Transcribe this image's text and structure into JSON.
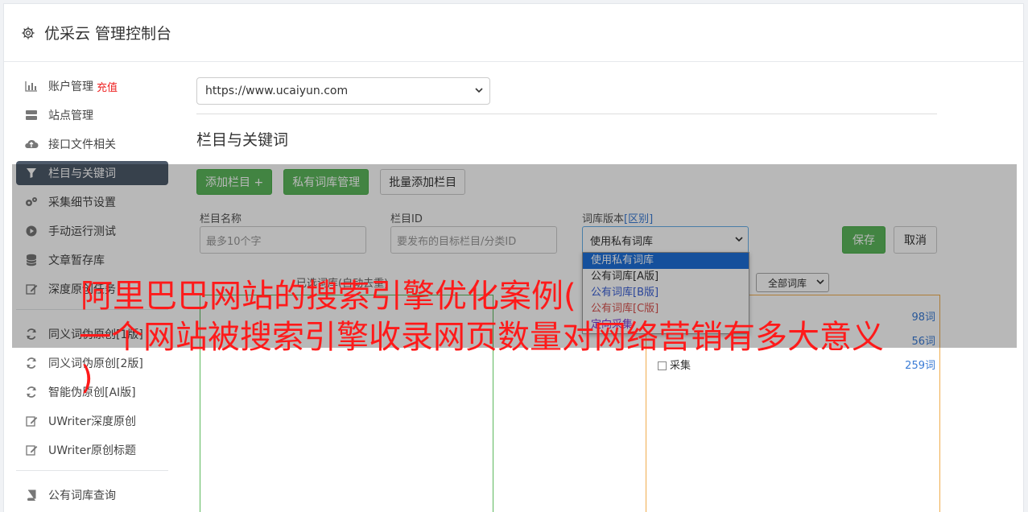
{
  "header": {
    "title": "优采云 管理控制台"
  },
  "sidebar": {
    "items": [
      {
        "label": "账户管理",
        "badge": "充值",
        "icon": "bar-chart-icon"
      },
      {
        "label": "站点管理",
        "icon": "server-icon"
      },
      {
        "label": "接口文件相关",
        "icon": "cloud-upload-icon"
      },
      {
        "label": "栏目与关键词",
        "icon": "filter-icon",
        "active": true
      },
      {
        "label": "采集细节设置",
        "icon": "gears-icon"
      },
      {
        "label": "手动运行测试",
        "icon": "play-circle-icon"
      },
      {
        "label": "文章暂存库",
        "icon": "database-icon"
      },
      {
        "label": "深度原创任务",
        "icon": "edit-icon"
      }
    ],
    "items2": [
      {
        "label": "同义词伪原创[1版]",
        "icon": "refresh-icon"
      },
      {
        "label": "同义词伪原创[2版]",
        "icon": "refresh-icon"
      },
      {
        "label": "智能伪原创[AI版]",
        "icon": "refresh-icon"
      },
      {
        "label": "UWriter深度原创",
        "icon": "edit-icon"
      },
      {
        "label": "UWriter原创标题",
        "icon": "edit-icon"
      }
    ],
    "items3": [
      {
        "label": "公有词库查询",
        "icon": "book-icon"
      }
    ]
  },
  "content": {
    "site_select": "https://www.ucaiyun.com",
    "section_title": "栏目与关键词",
    "buttons": {
      "add_column": "添加栏目 +",
      "private_lib": "私有词库管理",
      "batch_add": "批量添加栏目"
    },
    "form": {
      "name_label": "栏目名称",
      "name_placeholder": "最多10个字",
      "id_label": "栏目ID",
      "id_placeholder": "要发布的目标栏目/分类ID",
      "lib_label": "词库版本",
      "lib_label_link": "[区别]",
      "lib_value": "使用私有词库",
      "save": "保存",
      "cancel": "取消"
    },
    "dropdown_options": [
      "使用私有词库",
      "公有词库[A版]",
      "公有词库[B版]",
      "公有词库[C版]",
      "定向采集"
    ],
    "panel_label": "已选词库(自动去重)",
    "lib_filter": "全部词库",
    "lib_rows": [
      {
        "name": "",
        "count": "98词"
      },
      {
        "name": "",
        "count": "56词"
      },
      {
        "name": "采集",
        "count": "259词"
      }
    ]
  },
  "headline": {
    "line1": "阿里巴巴网站的搜索引擎优化案例(",
    "line2": "一个网站被搜索引擎收录网页数量对网络营销有多大意义",
    "line3": ")"
  },
  "colors": {
    "accent_green": "#5cb85c",
    "headline_red": "#ff1a1a",
    "active_nav": "#4d5a6a"
  }
}
